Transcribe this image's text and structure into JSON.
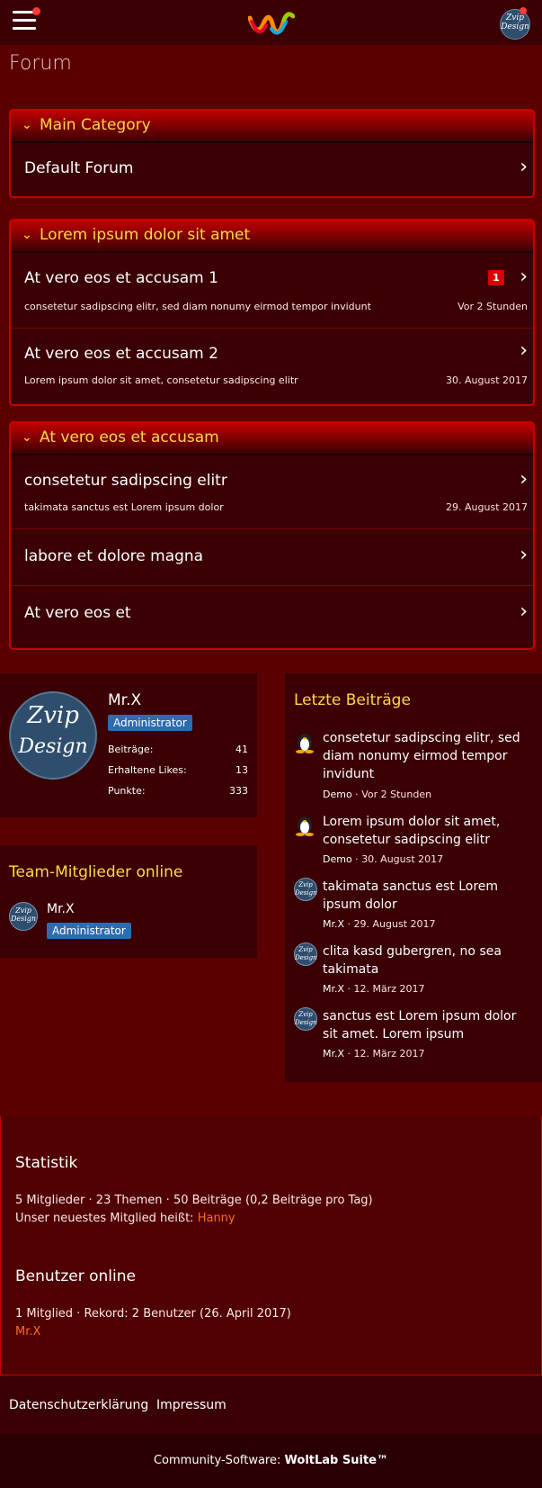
{
  "page": {
    "title": "Forum"
  },
  "categories": [
    {
      "title": "Main Category",
      "boards": [
        {
          "name": "Default Forum"
        }
      ]
    },
    {
      "title": "Lorem ipsum dolor sit amet",
      "boards": [
        {
          "name": "At vero eos et accusam 1",
          "description": "consetetur sadipscing elitr, sed diam nonumy eirmod tempor invidunt",
          "badge": "1",
          "time": "Vor 2 Stunden"
        },
        {
          "name": "At vero eos et accusam 2",
          "description": "Lorem ipsum dolor sit amet, consetetur sadipscing elitr",
          "time": "30. August 2017"
        }
      ]
    },
    {
      "title": "At vero eos et accusam",
      "boards": [
        {
          "name": "consetetur sadipscing elitr",
          "description": "takimata sanctus est Lorem ipsum dolor",
          "time": "29. August 2017"
        },
        {
          "name": "labore et dolore magna"
        },
        {
          "name": "At vero eos et"
        }
      ]
    }
  ],
  "profile": {
    "avatar_text": [
      "Zvip",
      "Design"
    ],
    "name": "Mr.X",
    "rank": "Administrator",
    "stats": [
      {
        "label": "Beiträge:",
        "value": "41"
      },
      {
        "label": "Erhaltene Likes:",
        "value": "13"
      },
      {
        "label": "Punkte:",
        "value": "333"
      }
    ]
  },
  "team_online": {
    "title": "Team-Mitglieder online",
    "member": {
      "name": "Mr.X",
      "rank": "Administrator",
      "avatar_text": [
        "Zvip",
        "Design"
      ]
    }
  },
  "recent_posts": {
    "title": "Letzte Beiträge",
    "items": [
      {
        "title": "consetetur sadipscing elitr, sed diam nonumy eirmod tempor invidunt",
        "author": "Demo",
        "time": "Vor 2 Stunden",
        "avatar": "tux-icon"
      },
      {
        "title": "Lorem ipsum dolor sit amet, consetetur sadipscing elitr",
        "author": "Demo",
        "time": "30. August 2017",
        "avatar": "tux-icon"
      },
      {
        "title": "takimata sanctus est Lorem ipsum dolor",
        "author": "Mr.X",
        "time": "29. August 2017",
        "avatar": "zvip-avatar"
      },
      {
        "title": "clita kasd gubergren, no sea takimata",
        "author": "Mr.X",
        "time": "12. März 2017",
        "avatar": "zvip-avatar"
      },
      {
        "title": "sanctus est Lorem ipsum dolor sit amet. Lorem ipsum",
        "author": "Mr.X",
        "time": "12. März 2017",
        "avatar": "zvip-avatar"
      }
    ]
  },
  "statistics": {
    "title": "Statistik",
    "line1": "5 Mitglieder · 23 Themen · 50 Beiträge (0,2 Beiträge pro Tag)",
    "newest_prefix": "Unser neuestes Mitglied heißt:",
    "newest_member": "Hanny"
  },
  "users_online": {
    "title": "Benutzer online",
    "line1": "1 Mitglied · Rekord: 2 Benutzer (26. April 2017)",
    "members": "Mr.X"
  },
  "footer": {
    "links": [
      "Datenschutzerklärung",
      "Impressum"
    ],
    "copyright_prefix": "Community-Software:",
    "copyright_brand": "WoltLab Suite™"
  },
  "colors": {
    "page_bg": "#5a0000",
    "panel_bg": "#3a0004",
    "border_accent": "#c80000",
    "heading_yellow": "#ffd84a",
    "badge_blue": "#2e6cb0",
    "link_orange": "#ff6a22"
  }
}
